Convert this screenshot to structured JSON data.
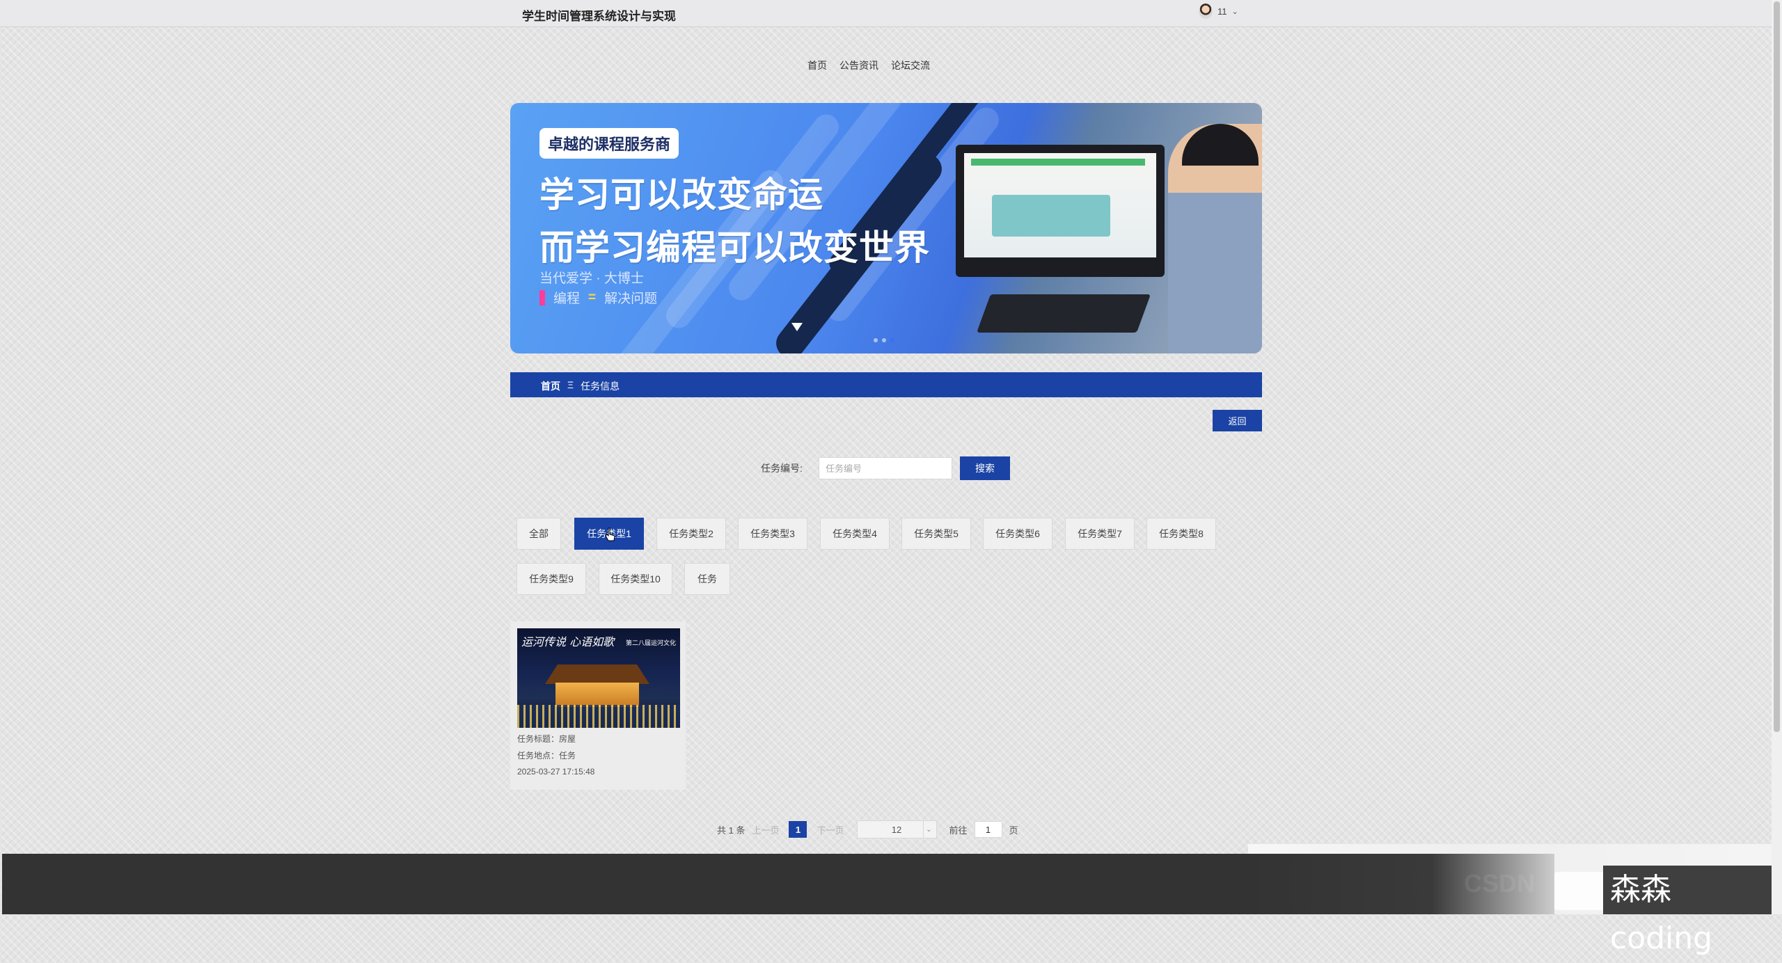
{
  "site": {
    "title": "学生时间管理系统设计与实现"
  },
  "user": {
    "name": "11"
  },
  "nav": [
    {
      "label": "首页"
    },
    {
      "label": "公告资讯"
    },
    {
      "label": "论坛交流"
    }
  ],
  "banner": {
    "tag": "卓越的课程服务商",
    "line1": "学习可以改变命运",
    "line2": "而学习编程可以改变世界",
    "sub": "当代爱学 · 大博士",
    "sub2_a": "编程",
    "sub2_b": "解决问题"
  },
  "breadcrumb": {
    "home": "首页",
    "separator": "Ξ",
    "current": "任务信息"
  },
  "back_label": "返回",
  "search": {
    "label": "任务编号:",
    "placeholder": "任务编号",
    "button": "搜索"
  },
  "categories": [
    "全部",
    "任务类型1",
    "任务类型2",
    "任务类型3",
    "任务类型4",
    "任务类型5",
    "任务类型6",
    "任务类型7",
    "任务类型8",
    "任务类型9",
    "任务类型10",
    "任务"
  ],
  "active_category": "任务类型1",
  "items": [
    {
      "image_caption": "运河传说  心语如歌",
      "image_caption_small": "第二八届运河文化",
      "title": "任务标题：房屋",
      "location": "任务地点：任务",
      "time": "2025-03-27 17:15:48"
    }
  ],
  "pagination": {
    "total": "共 1 条",
    "prev": "上一页",
    "page": "1",
    "next": "下一页",
    "page_size": "12",
    "goto_label": "前往",
    "goto_value": "1",
    "page_suffix": "页"
  },
  "watermark": "森森coding",
  "colors": {
    "primary": "#1a43a5",
    "footer": "#333333",
    "background": "#e4e4e4"
  }
}
